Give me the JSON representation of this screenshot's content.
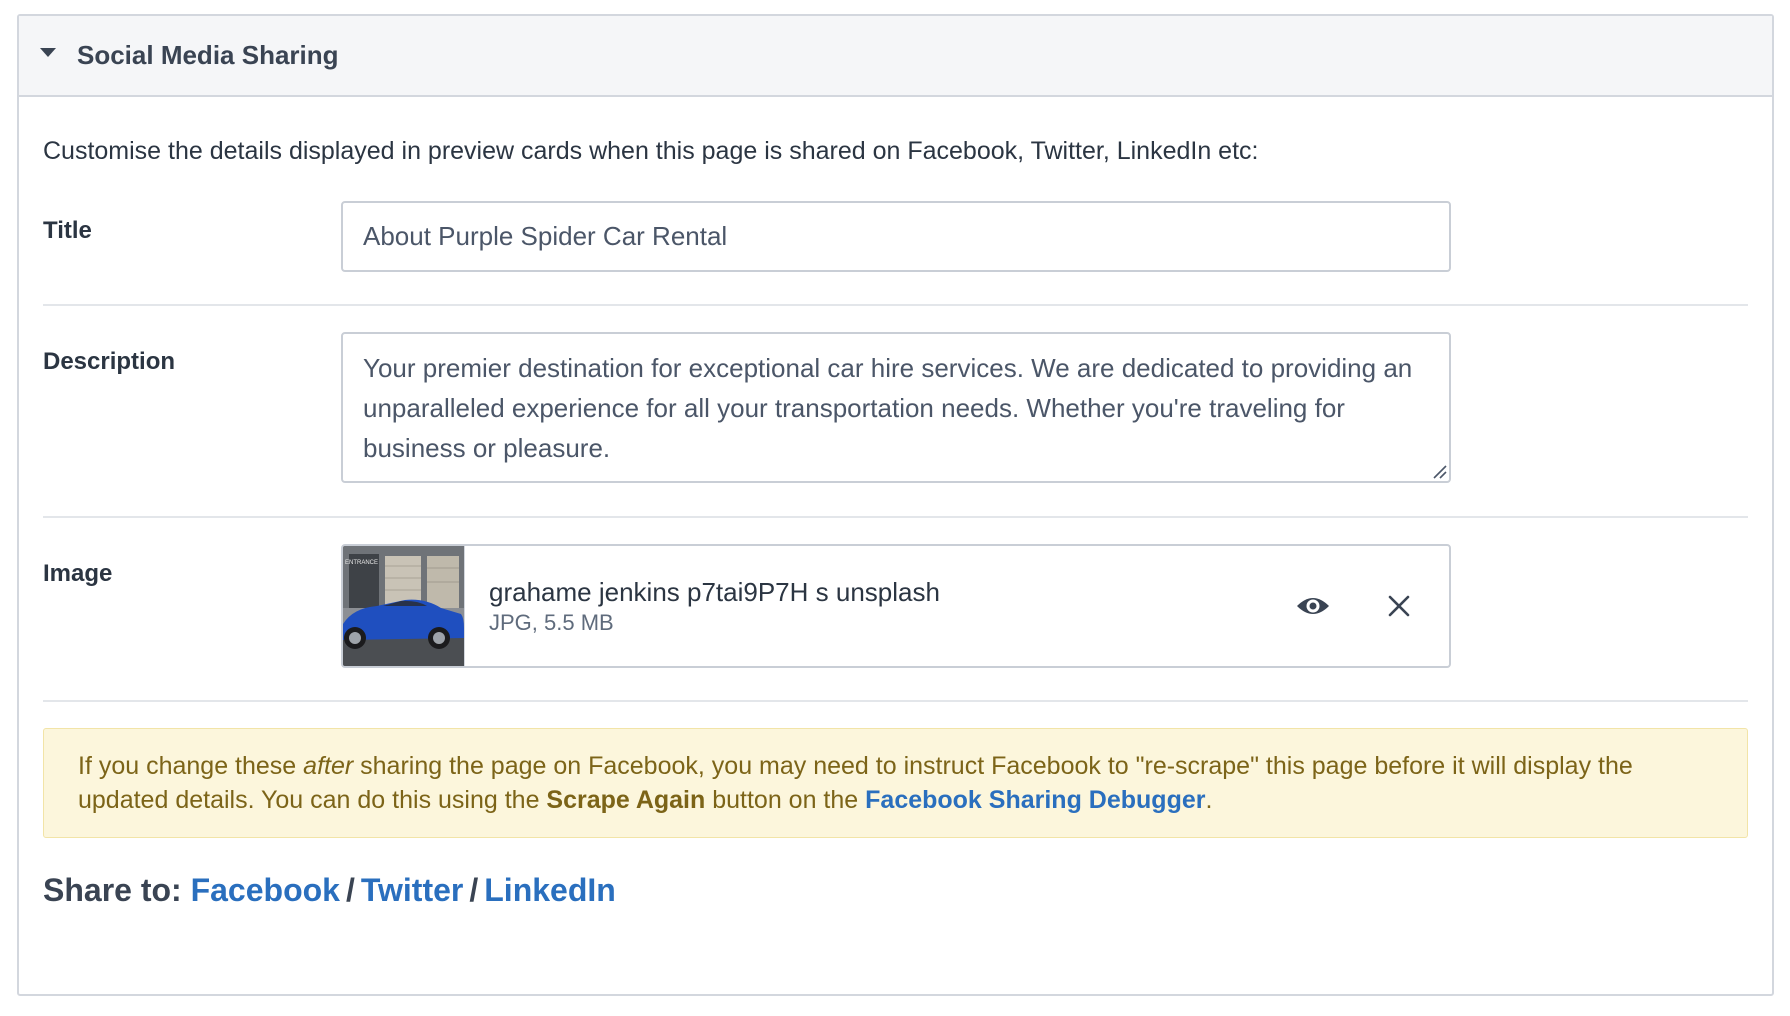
{
  "panel": {
    "title": "Social Media Sharing"
  },
  "intro": "Customise the details displayed in preview cards when this page is shared on Facebook, Twitter, LinkedIn etc:",
  "fields": {
    "title": {
      "label": "Title",
      "value": "About Purple Spider Car Rental"
    },
    "description": {
      "label": "Description",
      "value": "Your premier destination for exceptional car hire services. We are dedicated to providing an unparalleled experience for all your transportation needs. Whether you're traveling for business or pleasure."
    },
    "image": {
      "label": "Image",
      "file_name": "grahame jenkins p7tai9P7H s unsplash",
      "file_meta": "JPG, 5.5 MB",
      "thumb_text": "ENTRANCE"
    }
  },
  "notice": {
    "part1": "If you change these ",
    "emphasis": "after",
    "part2": " sharing the page on Facebook, you may need to instruct Facebook to \"re-scrape\" this page before it will display the updated details. You can do this using the ",
    "button_name": "Scrape Again",
    "part3": " button on the ",
    "link_text": "Facebook Sharing Debugger",
    "part4": "."
  },
  "share": {
    "label": "Share to: ",
    "separator": "/",
    "links": [
      "Facebook",
      "Twitter",
      "LinkedIn"
    ]
  },
  "colors": {
    "link": "#2a6fbe",
    "notice_bg": "#fcf6dc",
    "notice_text": "#7c6418",
    "header_bg": "#f5f6f8"
  }
}
